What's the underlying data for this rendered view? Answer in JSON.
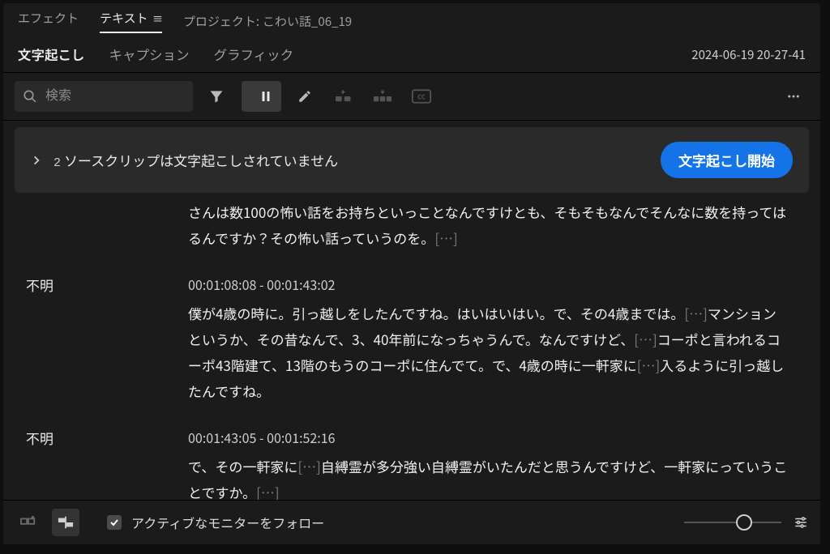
{
  "top_tabs": {
    "effect": "エフェクト",
    "text": "テキスト",
    "project_prefix": "プロジェクト:",
    "project_name": "こわい話_06_19"
  },
  "sub_tabs": {
    "transcript": "文字起こし",
    "caption": "キャプション",
    "graphic": "グラフィック"
  },
  "header_timestamp": "2024-06-19 20-27-41",
  "search": {
    "placeholder": "検索"
  },
  "banner": {
    "count": "2",
    "msg": "ソースクリップは文字起こしされていません",
    "cta": "文字起こし開始"
  },
  "segments": [
    {
      "speaker": "",
      "tc": "",
      "text_pre": "さんは数100の怖い話をお持ちといっことなんですけとも、そもそもなんでそんなに数を持ってはるんですか？その怖い話っていうのを。",
      "ellips": "[…]"
    },
    {
      "speaker": "不明",
      "tc": "00:01:08:08 - 00:01:43:02",
      "text_pre": "僕が4歳の時に。引っ越しをしたんですね。はいはいはい。で、その4歳までは。",
      "e1": "[…]",
      "text_mid": "マンションというか、その昔なんで、3、40年前になっちゃうんで。なんですけど、",
      "e2": "[…]",
      "text_mid2": "コーポと言われるコーポ43階建て、13階のもうのコーポに住んでて。で、4歳の時に一軒家に",
      "e3": "[…]",
      "text_end": "入るように引っ越したんですね。"
    },
    {
      "speaker": "不明",
      "tc": "00:01:43:05 - 00:01:52:16",
      "text_pre": "で、その一軒家に",
      "e1": "[…]",
      "text_mid": "自縛霊が多分強い自縛霊がいたんだと思うんですけど、一軒家にっていうことですか。",
      "e2": "[…]"
    }
  ],
  "footer": {
    "follow": "アクティブなモニターをフォロー"
  }
}
